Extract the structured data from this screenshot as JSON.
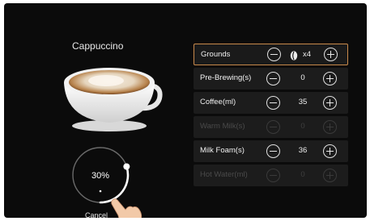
{
  "drink": {
    "title": "Cappuccino"
  },
  "progress": {
    "percent_text": "30%",
    "value": 0.3
  },
  "cancel_label": "Cancel",
  "settings": [
    {
      "label": "Grounds",
      "value": "x4",
      "state": "active",
      "icon": "coffee-bean-icon"
    },
    {
      "label": "Pre-Brewing(s)",
      "value": "0",
      "state": "enabled"
    },
    {
      "label": "Coffee(ml)",
      "value": "35",
      "state": "enabled"
    },
    {
      "label": "Warm Milk(s)",
      "value": "0",
      "state": "disabled"
    },
    {
      "label": "Milk Foam(s)",
      "value": "36",
      "state": "enabled"
    },
    {
      "label": "Hot Water(ml)",
      "value": "0",
      "state": "disabled"
    }
  ],
  "colors": {
    "background": "#0b0b0b",
    "active_border": "#c98a4b",
    "row_bg": "#1c1c1c"
  }
}
